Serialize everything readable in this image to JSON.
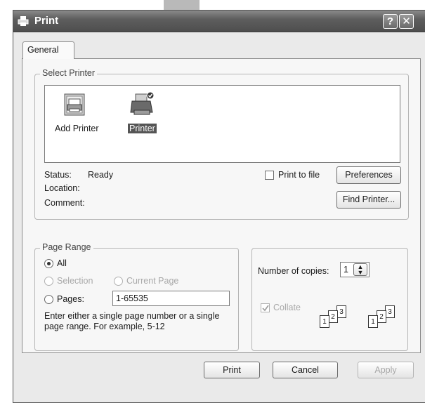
{
  "window": {
    "title": "Print"
  },
  "tabs": [
    {
      "label": "General"
    }
  ],
  "select_printer": {
    "legend": "Select Printer",
    "items": [
      {
        "label": "Add Printer",
        "icon": "add-printer-icon"
      },
      {
        "label": "Printer",
        "icon": "printer-icon",
        "selected": true
      }
    ],
    "status_label": "Status:",
    "status_value": "Ready",
    "location_label": "Location:",
    "comment_label": "Comment:",
    "print_to_file_label": "Print to file",
    "preferences_label": "Preferences",
    "find_printer_label": "Find Printer..."
  },
  "page_range": {
    "legend": "Page Range",
    "all_label": "All",
    "selection_label": "Selection",
    "current_page_label": "Current Page",
    "pages_label": "Pages:",
    "pages_value": "1-65535",
    "hint": "Enter either a single page number or a single page range.  For example, 5-12"
  },
  "copies": {
    "label": "Number of copies:",
    "value": "1",
    "collate_label": "Collate",
    "collate_checked": true
  },
  "buttons": {
    "print": "Print",
    "cancel": "Cancel",
    "apply": "Apply"
  }
}
